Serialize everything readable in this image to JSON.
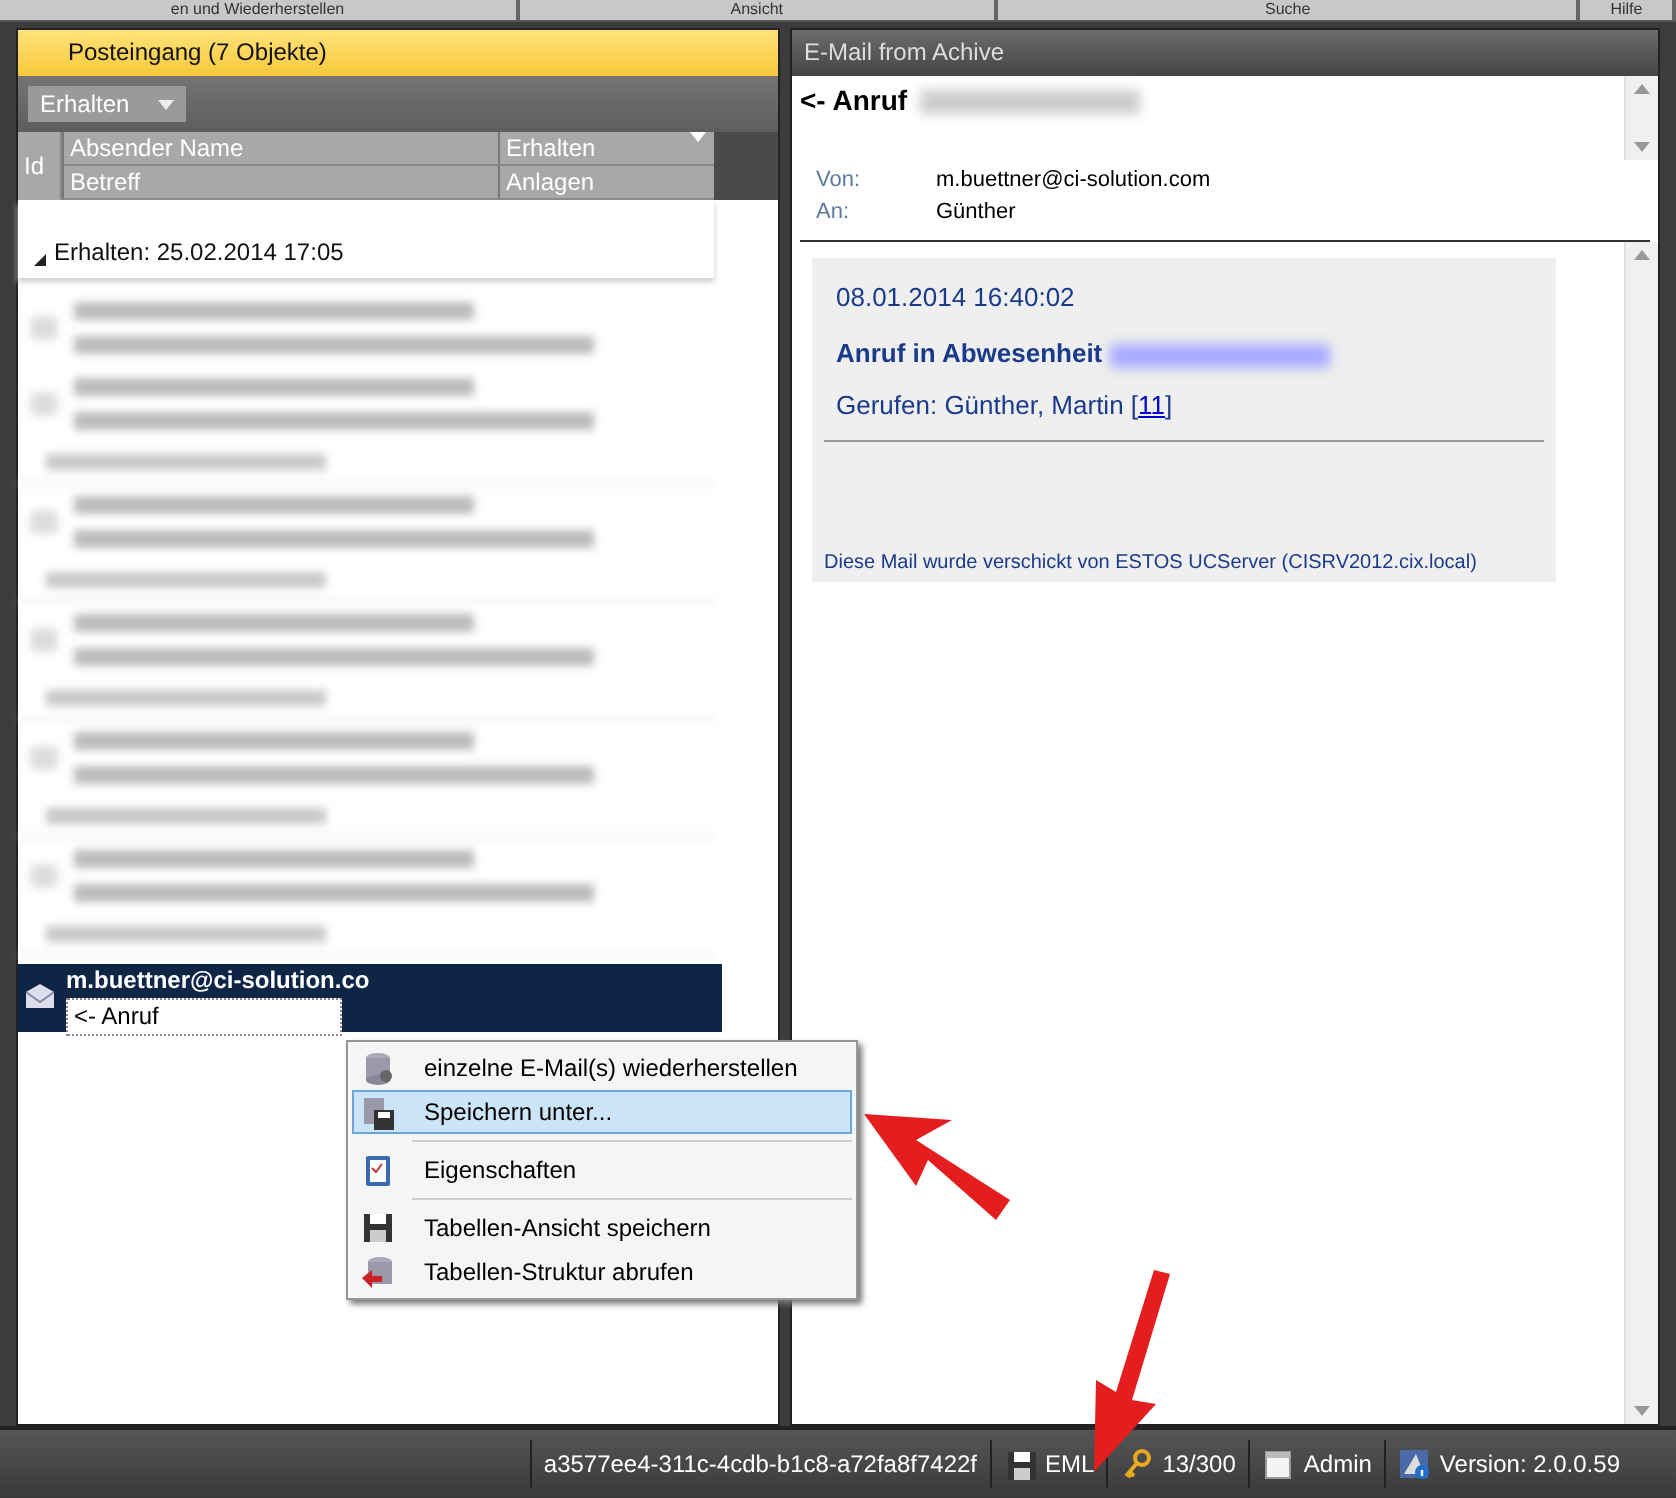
{
  "menu_strip": [
    {
      "label": "en und Wiederherstellen"
    },
    {
      "label": "Ansicht"
    },
    {
      "label": "Suche"
    },
    {
      "label": "Hilfe"
    }
  ],
  "list_panel": {
    "title": "Posteingang (7 Objekte)",
    "group_by_button": "Erhalten",
    "columns": {
      "id": "Id",
      "sender": "Absender Name",
      "received": "Erhalten",
      "subject": "Betreff",
      "attachments": "Anlagen"
    },
    "group_header": "Erhalten:  25.02.2014 17:05",
    "redacted_rows": [
      {
        "kind": "mail"
      },
      {
        "kind": "mail"
      },
      {
        "kind": "group"
      },
      {
        "kind": "mail"
      },
      {
        "kind": "group"
      },
      {
        "kind": "mail"
      },
      {
        "kind": "group"
      },
      {
        "kind": "mail"
      },
      {
        "kind": "group"
      },
      {
        "kind": "mail"
      },
      {
        "kind": "group"
      }
    ],
    "selected_mail": {
      "sender": "m.buettner@ci-solution.co",
      "subject": "<- Anruf",
      "selected": true
    }
  },
  "context_menu": [
    {
      "kind": "item",
      "label": "einzelne E-Mail(s) wiederherstellen",
      "selected": false
    },
    {
      "kind": "item",
      "label": "Speichern unter...",
      "selected": true
    },
    {
      "kind": "separator"
    },
    {
      "kind": "item",
      "label": "Eigenschaften",
      "selected": false
    },
    {
      "kind": "separator"
    },
    {
      "kind": "item",
      "label": "Tabellen-Ansicht speichern",
      "selected": false
    },
    {
      "kind": "item",
      "label": "Tabellen-Struktur abrufen",
      "selected": false
    }
  ],
  "preview_panel": {
    "title": "E-Mail from Achive",
    "subject": "<- Anruf",
    "from_label": "Von:",
    "from": "m.buettner@ci-solution.com",
    "to_label": "An:",
    "to": "Günther",
    "body": {
      "date": "08.01.2014 16:40:02",
      "heading": "Anruf in Abwesenheit",
      "called_text": "Gerufen: Günther, Martin [",
      "called_link": "11",
      "called_suffix": "]",
      "footer": "Diese Mail wurde verschickt von ESTOS UCServer (CISRV2012.cix.local)"
    }
  },
  "status_bar": [
    {
      "text": "a3577ee4-311c-4cdb-b1c8-a72fa8f7422f"
    },
    {
      "text": "EML"
    },
    {
      "text": "13/300"
    },
    {
      "text": "Admin"
    },
    {
      "text": "Version: 2.0.0.59"
    }
  ]
}
